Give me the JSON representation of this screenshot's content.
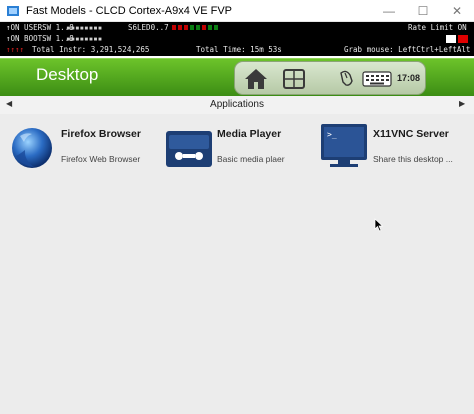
{
  "window": {
    "title": "Fast Models - CLCD Cortex-A9x4 VE FVP",
    "controls": [
      "—",
      "☐",
      "✕"
    ]
  },
  "status": {
    "row1_label": "↑ON USERSW 1..8",
    "row1_dots": "▪▪▪▪▪▪▪▪",
    "s6led": "S6LED0..7",
    "rate_limit": "Rate Limit  ON",
    "row2_label": "↑ON BOOTSW 1..8",
    "row2_dots": "▪▪▪▪▪▪▪▪",
    "row3_marks": "↑↑↑↑",
    "total_instr": "Total Instr: 3,291,524,265",
    "total_time": "Total Time:  15m 53s",
    "grab_mouse": "Grab mouse: LeftCtrl+LeftAlt",
    "led_colors": [
      "#c00000",
      "#c00000",
      "#c00000",
      "#0a7d12",
      "#0a7d12",
      "#c00000",
      "#0a7d12",
      "#0a7d12"
    ],
    "swatch_colors": [
      "#ffffff",
      "#e00000"
    ]
  },
  "topbar": {
    "title": "Desktop",
    "clock": "17:08",
    "tray_icons": [
      "home-icon",
      "windows-icon",
      "mouse-icon",
      "keyboard-icon"
    ],
    "accent": "#4fa31d"
  },
  "apps_header": {
    "label": "Applications",
    "left_arrow": "◀",
    "right_arrow": "▶"
  },
  "apps": [
    {
      "name": "Firefox Browser",
      "desc": "Firefox Web Browser",
      "icon": "firefox-icon"
    },
    {
      "name": "Media Player",
      "desc": "Basic media plaer",
      "icon": "media-player-icon"
    },
    {
      "name": "X11VNC Server",
      "desc": "Share this desktop ...",
      "icon": "vnc-monitor-icon"
    }
  ]
}
